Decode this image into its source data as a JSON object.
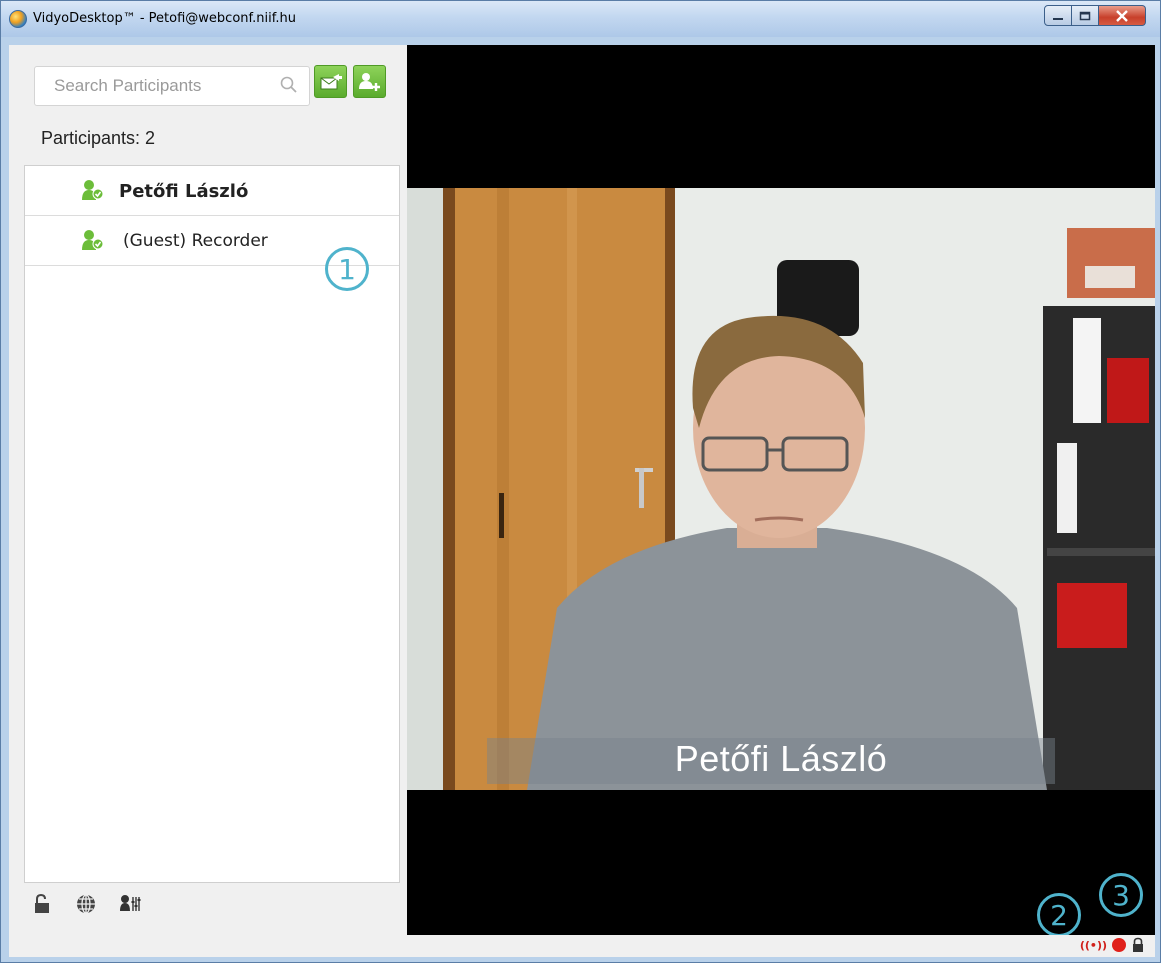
{
  "window": {
    "title": "VidyoDesktop™ - Petofi@webconf.niif.hu",
    "app_icon": "vidyo-app-icon",
    "controls": [
      "minimize-icon",
      "maximize-icon",
      "close-icon"
    ]
  },
  "sidebar": {
    "search": {
      "placeholder": "Search Participants",
      "value": "",
      "icon": "search-icon"
    },
    "buttons": [
      {
        "icon": "invite-envelope-icon"
      },
      {
        "icon": "add-user-icon"
      }
    ],
    "participants_count": "Participants: 2",
    "participants": [
      {
        "name": "Petőfi László",
        "icon": "participant-icon",
        "bold": true
      },
      {
        "name": "(Guest) Recorder",
        "icon": "participant-icon",
        "bold": false
      }
    ],
    "footer_icons": [
      "unlocked-padlock-icon",
      "globe-icon",
      "speaker-settings-icon"
    ]
  },
  "video": {
    "overlay_name": "Petőfi László"
  },
  "callouts": [
    "1",
    "2",
    "3"
  ],
  "statusbar": {
    "broadcast_text": "((•))",
    "icons": [
      "broadcast-icon",
      "recording-dot-icon",
      "lock-icon"
    ]
  },
  "colors": {
    "accent_green": "#5aab2d",
    "callout_blue": "#4fb3cc",
    "record_red": "#e0201a"
  }
}
